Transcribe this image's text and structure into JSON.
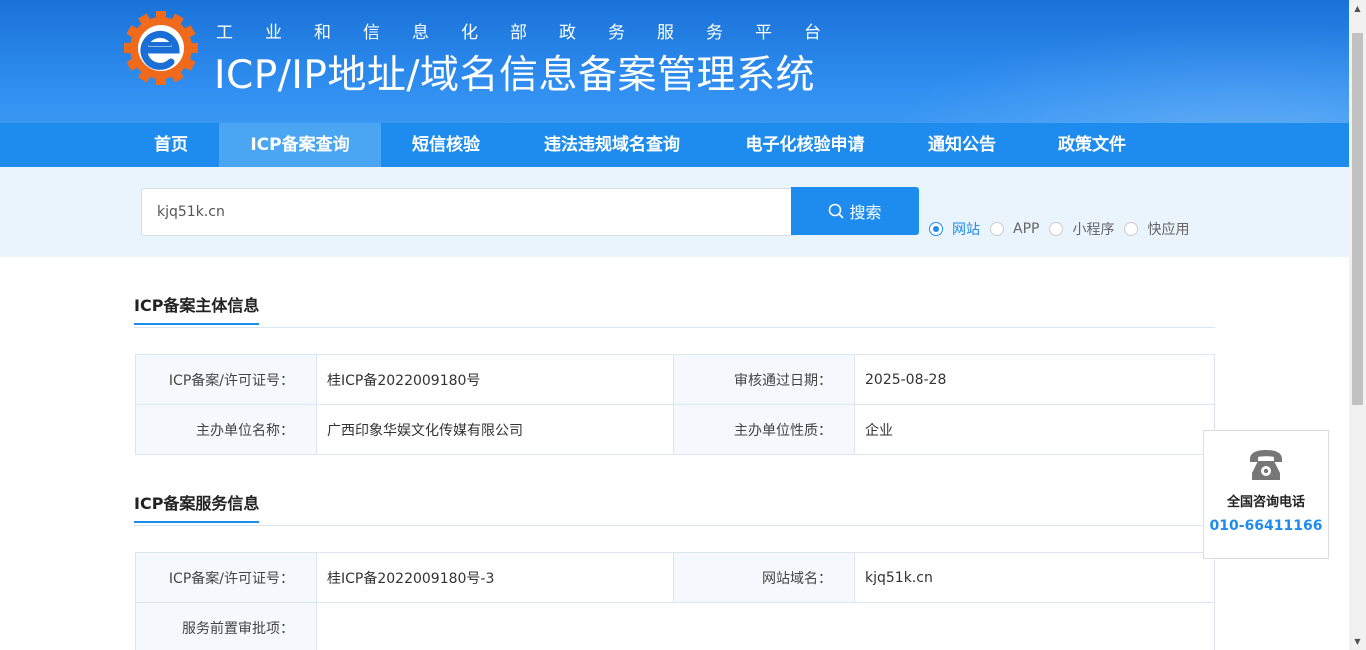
{
  "header": {
    "subtitle": "工业和信息化部政务服务平台",
    "title": "ICP/IP地址/域名信息备案管理系统"
  },
  "nav": {
    "items": [
      {
        "label": "首页"
      },
      {
        "label": "ICP备案查询"
      },
      {
        "label": "短信核验"
      },
      {
        "label": "违法违规域名查询"
      },
      {
        "label": "电子化核验申请"
      },
      {
        "label": "通知公告"
      },
      {
        "label": "政策文件"
      }
    ],
    "active_index": 1
  },
  "search": {
    "value": "kjq51k.cn",
    "button_label": "搜索",
    "options": [
      {
        "label": "网站",
        "checked": true
      },
      {
        "label": "APP",
        "checked": false
      },
      {
        "label": "小程序",
        "checked": false
      },
      {
        "label": "快应用",
        "checked": false
      }
    ]
  },
  "subject": {
    "title": "ICP备案主体信息",
    "rows": [
      {
        "label1": "ICP备案/许可证号：",
        "value1": "桂ICP备2022009180号",
        "label2": "审核通过日期：",
        "value2": "2025-08-28"
      },
      {
        "label1": "主办单位名称：",
        "value1": "广西印象华娱文化传媒有限公司",
        "label2": "主办单位性质：",
        "value2": "企业"
      }
    ]
  },
  "service": {
    "title": "ICP备案服务信息",
    "rows": [
      {
        "label1": "ICP备案/许可证号：",
        "value1": "桂ICP备2022009180号-3",
        "label2": "网站域名：",
        "value2": "kjq51k.cn"
      },
      {
        "label1": "服务前置审批项：",
        "value1": ""
      }
    ]
  },
  "contact": {
    "label": "全国咨询电话",
    "number": "010-66411166",
    "icon": "phone-icon"
  },
  "colors": {
    "primary": "#1e8cee",
    "nav_active": "#4aa6f3",
    "search_band": "#eaf4fd"
  }
}
